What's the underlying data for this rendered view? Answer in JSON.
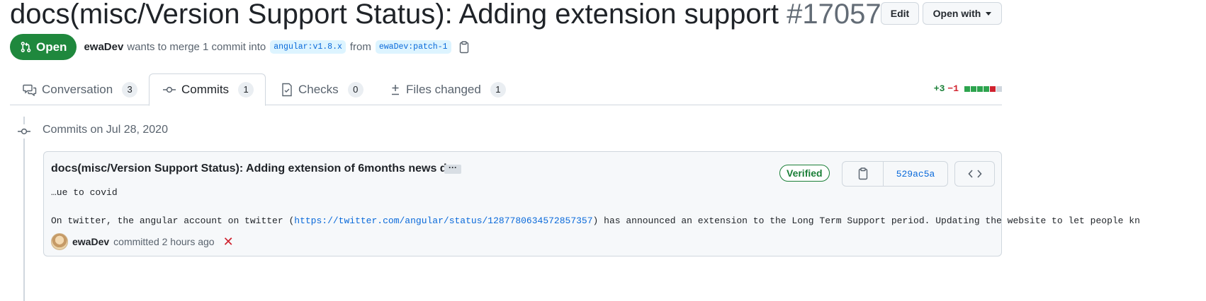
{
  "pr": {
    "title": "docs(misc/Version Support Status): Adding extension support",
    "number": "#17057",
    "state": "Open",
    "author": "ewaDev",
    "merge_text": "wants to merge 1 commit into",
    "base_branch": "angular:v1.8.x",
    "from_text": "from",
    "head_branch": "ewaDev:patch-1"
  },
  "header_actions": {
    "edit_label": "Edit",
    "open_with_label": "Open with"
  },
  "tabs": [
    {
      "label": "Conversation",
      "count": "3",
      "icon": "comment-discussion-icon"
    },
    {
      "label": "Commits",
      "count": "1",
      "icon": "git-commit-icon",
      "selected": true
    },
    {
      "label": "Checks",
      "count": "0",
      "icon": "checklist-icon"
    },
    {
      "label": "Files changed",
      "count": "1",
      "icon": "file-diff-icon"
    }
  ],
  "diffstat": {
    "additions": "+3",
    "deletions": "−1",
    "blocks": [
      "#2da44e",
      "#2da44e",
      "#2da44e",
      "#2da44e",
      "#cf222e",
      "#d0d7de"
    ]
  },
  "commits": {
    "group_label": "Commits on Jul 28, 2020",
    "items": [
      {
        "title": "docs(misc/Version Support Status): Adding extension of 6months news d...",
        "ellipsis": "···",
        "description_line1": "…ue to covid",
        "description_line2_prefix": "On twitter, the angular account on twitter (",
        "description_link": "https://twitter.com/angular/status/1287780634572857357",
        "description_line2_suffix": ") has announced an extension to the Long Term Support period. Updating the website to let people kn",
        "author": "ewaDev",
        "committed_text": "committed 2 hours ago",
        "status_mark": "✕",
        "verified_label": "Verified",
        "sha": "529ac5a"
      }
    ]
  },
  "colors": {
    "open_green": "#1f883d",
    "link_blue": "#0969da",
    "border": "#d0d7de",
    "muted_text": "#59636e"
  }
}
